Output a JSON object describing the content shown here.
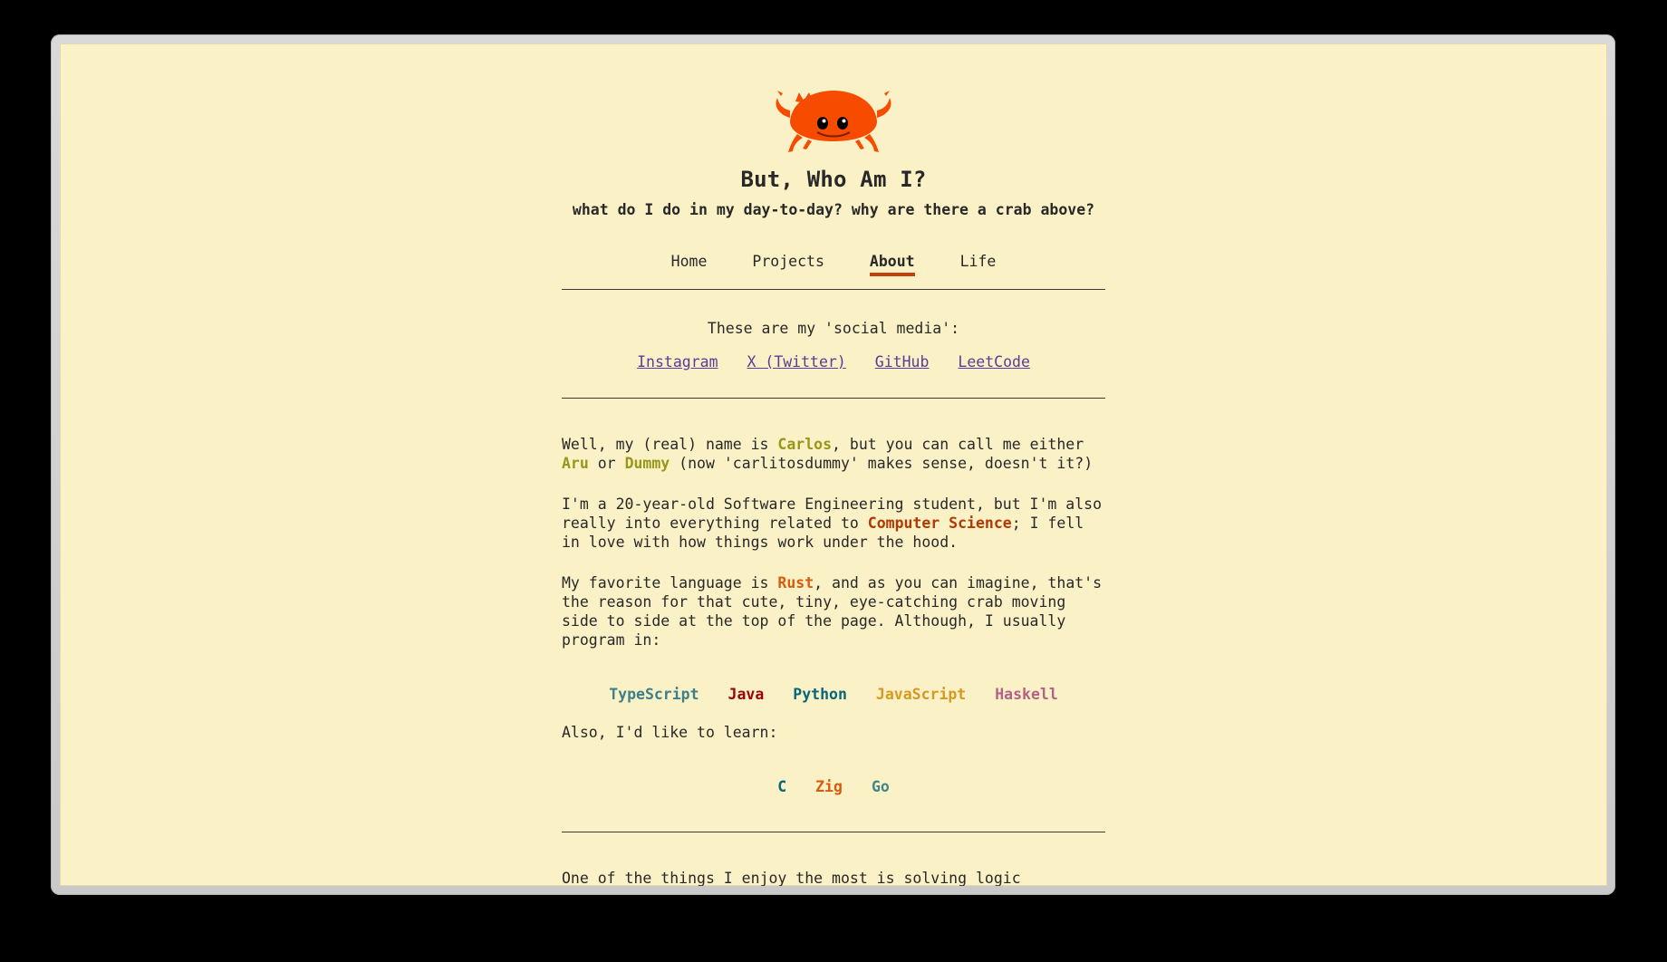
{
  "header": {
    "title": "But, Who Am I?",
    "subtitle": "what do I do in my day-to-day? why are there a crab above?"
  },
  "nav": [
    {
      "label": "Home",
      "active": false
    },
    {
      "label": "Projects",
      "active": false
    },
    {
      "label": "About",
      "active": true
    },
    {
      "label": "Life",
      "active": false
    }
  ],
  "social": {
    "label": "These are my 'social media':",
    "links": [
      "Instagram",
      "X (Twitter)",
      "GitHub",
      "LeetCode"
    ]
  },
  "bio": {
    "p1": {
      "t1": "Well, my (real) name is ",
      "name": "Carlos",
      "t2": ", but you can call me either ",
      "alias1": "Aru",
      "t3": " or ",
      "alias2": "Dummy",
      "t4": " (now 'carlitosdummy' makes sense, doesn't it?)"
    },
    "p2": {
      "t1": "I'm a 20-year-old Software Engineering student, but I'm also really into everything related to ",
      "hl": "Computer Science",
      "t2": "; I fell in love with how things work under the hood."
    },
    "p3": {
      "t1": "My favorite language is ",
      "hl": "Rust",
      "t2": ", and as you can imagine, that's the reason for that cute, tiny, eye-catching crab moving side to side at the top of the page. Although, I usually program in:"
    },
    "languages": [
      {
        "name": "TypeScript",
        "color": "#3f7f8c"
      },
      {
        "name": "Java",
        "color": "#9d0006"
      },
      {
        "name": "Python",
        "color": "#076678"
      },
      {
        "name": "JavaScript",
        "color": "#d79921"
      },
      {
        "name": "Haskell",
        "color": "#b16286"
      }
    ],
    "p4": "Also, I'd like to learn:",
    "to_learn": [
      {
        "name": "C",
        "color": "#076678"
      },
      {
        "name": "Zig",
        "color": "#d65d0e"
      },
      {
        "name": "Go",
        "color": "#458588"
      }
    ],
    "p5": "One of the things I enjoy the most is solving logic problems. I'm ..."
  },
  "colors": {
    "background": "#fbf1c7",
    "accent": "#c2410c",
    "crab": "#f74c00"
  }
}
